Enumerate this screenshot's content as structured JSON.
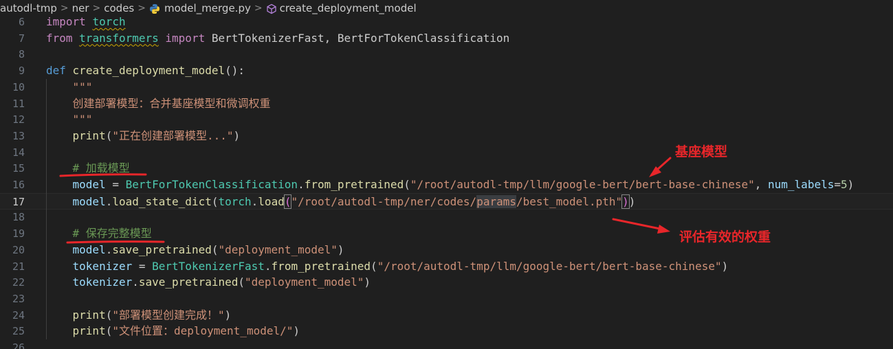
{
  "breadcrumb": {
    "items": [
      "autodl-tmp",
      "ner",
      "codes",
      "model_merge.py",
      "create_deployment_model"
    ],
    "separator": ">",
    "file_icon": "python-icon",
    "symbol_icon": "method-cube-icon"
  },
  "editor": {
    "active_line": "17",
    "lines": [
      {
        "n": "6",
        "tokens": [
          {
            "t": "import",
            "c": "kw2"
          },
          {
            "t": " "
          },
          {
            "t": "torch",
            "c": "cls squig"
          }
        ]
      },
      {
        "n": "7",
        "tokens": [
          {
            "t": "from",
            "c": "kw2"
          },
          {
            "t": " "
          },
          {
            "t": "transformers",
            "c": "cls squig"
          },
          {
            "t": " "
          },
          {
            "t": "import",
            "c": "kw2"
          },
          {
            "t": " BertTokenizerFast, BertForTokenClassification"
          }
        ]
      },
      {
        "n": "8",
        "tokens": []
      },
      {
        "n": "9",
        "tokens": [
          {
            "t": "def",
            "c": "kw"
          },
          {
            "t": " "
          },
          {
            "t": "create_deployment_model",
            "c": "fn"
          },
          {
            "t": "("
          },
          {
            "t": "):"
          }
        ]
      },
      {
        "n": "10",
        "tokens": [
          {
            "t": "    "
          },
          {
            "t": "\"\"\"",
            "c": "str"
          }
        ]
      },
      {
        "n": "11",
        "tokens": [
          {
            "t": "    "
          },
          {
            "t": "创建部署模型：合并基座模型和微调权重",
            "c": "str"
          }
        ]
      },
      {
        "n": "12",
        "tokens": [
          {
            "t": "    "
          },
          {
            "t": "\"\"\"",
            "c": "str"
          }
        ]
      },
      {
        "n": "13",
        "tokens": [
          {
            "t": "    "
          },
          {
            "t": "print",
            "c": "fn"
          },
          {
            "t": "("
          },
          {
            "t": "\"正在创建部署模型...\"",
            "c": "str"
          },
          {
            "t": ")"
          }
        ]
      },
      {
        "n": "14",
        "tokens": []
      },
      {
        "n": "15",
        "tokens": [
          {
            "t": "    "
          },
          {
            "t": "# 加载模型",
            "c": "cm"
          }
        ]
      },
      {
        "n": "16",
        "tokens": [
          {
            "t": "    "
          },
          {
            "t": "model",
            "c": "var"
          },
          {
            "t": " = "
          },
          {
            "t": "BertForTokenClassification",
            "c": "cls"
          },
          {
            "t": "."
          },
          {
            "t": "from_pretrained",
            "c": "fn"
          },
          {
            "t": "("
          },
          {
            "t": "\"/root/autodl-tmp/llm/google-bert/bert-base-chinese\"",
            "c": "str"
          },
          {
            "t": ", "
          },
          {
            "t": "num_labels",
            "c": "var"
          },
          {
            "t": "="
          },
          {
            "t": "5",
            "c": "num"
          },
          {
            "t": ")"
          }
        ]
      },
      {
        "n": "17",
        "tokens": [
          {
            "t": "    "
          },
          {
            "t": "model",
            "c": "var"
          },
          {
            "t": "."
          },
          {
            "t": "load_state_dict",
            "c": "fn"
          },
          {
            "t": "("
          },
          {
            "t": "torch",
            "c": "cls"
          },
          {
            "t": "."
          },
          {
            "t": "load",
            "c": "fn"
          },
          {
            "t": "(",
            "c": "br2 box"
          },
          {
            "t": "\"/root/autodl-tmp/ner/codes/",
            "c": "str"
          },
          {
            "t": "params",
            "c": "str hl"
          },
          {
            "t": "/best_model.pth\"",
            "c": "str"
          },
          {
            "t": ")",
            "c": "br2 box"
          },
          {
            "t": ")"
          }
        ]
      },
      {
        "n": "18",
        "tokens": []
      },
      {
        "n": "19",
        "tokens": [
          {
            "t": "    "
          },
          {
            "t": "# 保存完整模型",
            "c": "cm"
          }
        ]
      },
      {
        "n": "20",
        "tokens": [
          {
            "t": "    "
          },
          {
            "t": "model",
            "c": "var"
          },
          {
            "t": "."
          },
          {
            "t": "save_pretrained",
            "c": "fn"
          },
          {
            "t": "("
          },
          {
            "t": "\"deployment_model\"",
            "c": "str"
          },
          {
            "t": ")"
          }
        ]
      },
      {
        "n": "21",
        "tokens": [
          {
            "t": "    "
          },
          {
            "t": "tokenizer",
            "c": "var"
          },
          {
            "t": " = "
          },
          {
            "t": "BertTokenizerFast",
            "c": "cls"
          },
          {
            "t": "."
          },
          {
            "t": "from_pretrained",
            "c": "fn"
          },
          {
            "t": "("
          },
          {
            "t": "\"/root/autodl-tmp/llm/google-bert/bert-base-chinese\"",
            "c": "str"
          },
          {
            "t": ")"
          }
        ]
      },
      {
        "n": "22",
        "tokens": [
          {
            "t": "    "
          },
          {
            "t": "tokenizer",
            "c": "var"
          },
          {
            "t": "."
          },
          {
            "t": "save_pretrained",
            "c": "fn"
          },
          {
            "t": "("
          },
          {
            "t": "\"deployment_model\"",
            "c": "str"
          },
          {
            "t": ")"
          }
        ]
      },
      {
        "n": "23",
        "tokens": []
      },
      {
        "n": "24",
        "tokens": [
          {
            "t": "    "
          },
          {
            "t": "print",
            "c": "fn"
          },
          {
            "t": "("
          },
          {
            "t": "\"部署模型创建完成！\"",
            "c": "str"
          },
          {
            "t": ")"
          }
        ]
      },
      {
        "n": "25",
        "tokens": [
          {
            "t": "    "
          },
          {
            "t": "print",
            "c": "fn"
          },
          {
            "t": "("
          },
          {
            "t": "\"文件位置：deployment_model/\"",
            "c": "str"
          },
          {
            "t": ")"
          }
        ]
      },
      {
        "n": "26",
        "tokens": []
      }
    ]
  },
  "annotations": {
    "base_model_label": "基座模型",
    "effective_weights_label": "评估有效的权重",
    "color": "#e8262a"
  },
  "theme": {
    "background": "#1f1f1f",
    "keyword": "#569cd6",
    "control_keyword": "#c586c0",
    "function": "#dcdcaa",
    "string": "#ce9178",
    "comment": "#6a9955",
    "variable": "#9cdcfe",
    "class": "#4ec9b0",
    "number": "#b5cea8"
  }
}
